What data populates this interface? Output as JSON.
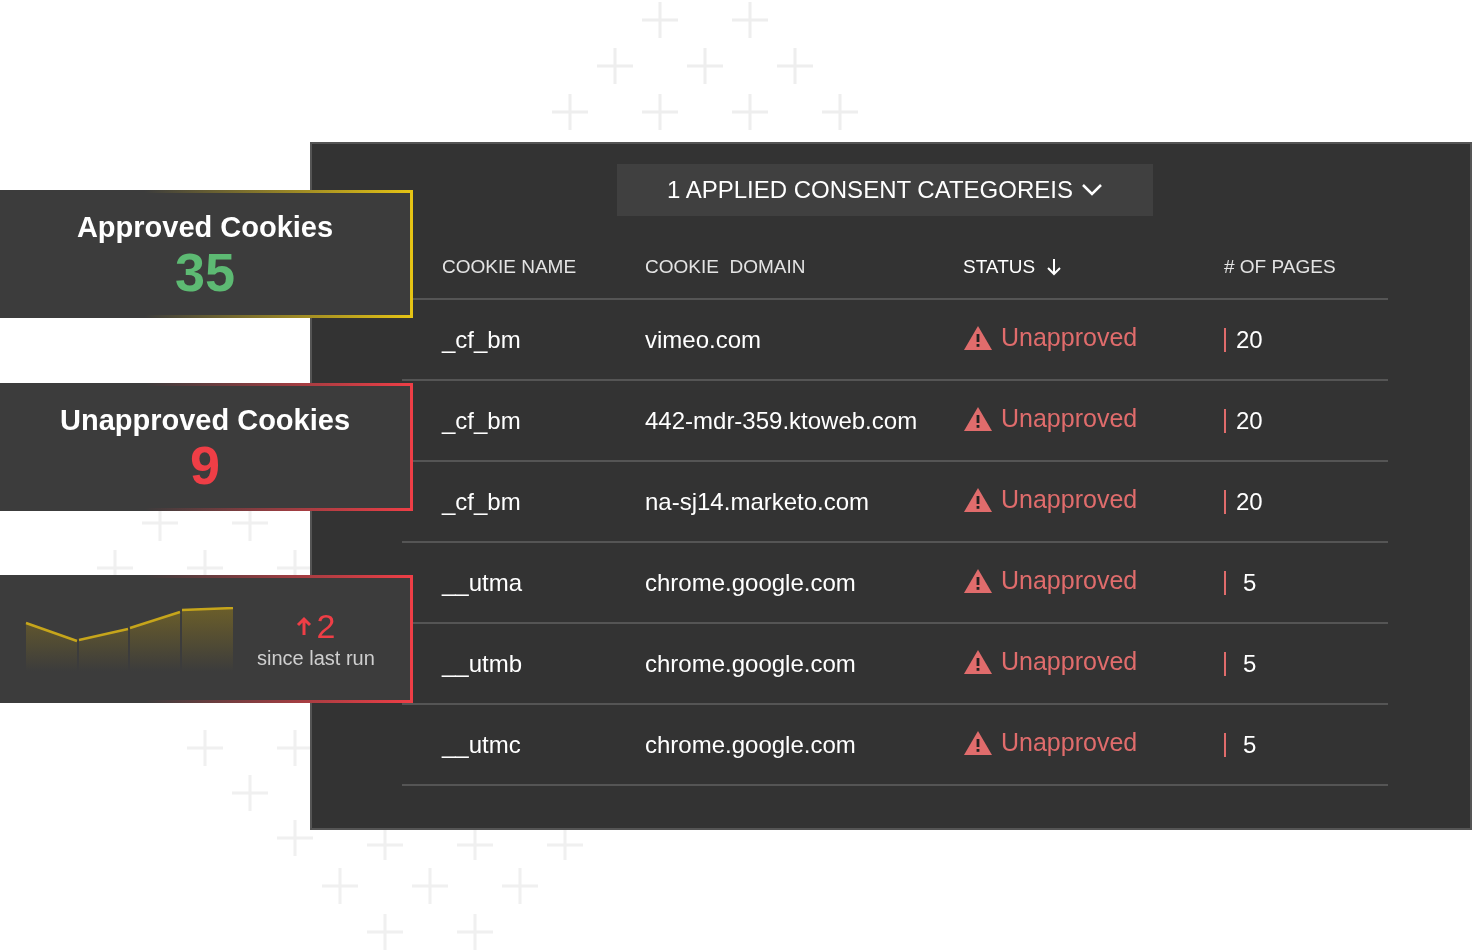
{
  "stat_cards": [
    {
      "kind": "approved",
      "title": "Approved Cookies",
      "value": "35"
    },
    {
      "kind": "unapproved",
      "title": "Unapproved Cookies",
      "value": "9"
    },
    {
      "kind": "trend",
      "change": "2",
      "caption": "since last run"
    }
  ],
  "panel": {
    "filter_button": "1 APPLIED CONSENT CATEGOREIS",
    "table": {
      "columns": [
        {
          "label": "COOKIE NAME",
          "sorted": false
        },
        {
          "label": "COOKIE  DOMAIN",
          "sorted": false
        },
        {
          "label": "STATUS",
          "sorted": true
        },
        {
          "label": "# OF PAGES",
          "sorted": false
        }
      ],
      "rows": [
        {
          "kind": "warning",
          "name": "_cf_bm",
          "domain": "vimeo.com",
          "status": "Unapproved",
          "pages": "20"
        },
        {
          "kind": "warning",
          "name": "_cf_bm",
          "domain": "442-mdr-359.ktoweb.com",
          "status": "Unapproved",
          "pages": "20"
        },
        {
          "kind": "warning",
          "name": "_cf_bm",
          "domain": "na-sj14.marketo.com",
          "status": "Unapproved",
          "pages": "20"
        },
        {
          "kind": "warning",
          "name": "__utma",
          "domain": "chrome.google.com",
          "status": "Unapproved",
          "pages": "5"
        },
        {
          "kind": "warning",
          "name": "__utmb",
          "domain": "chrome.google.com",
          "status": "Unapproved",
          "pages": "5"
        },
        {
          "kind": "warning",
          "name": "__utmc",
          "domain": "chrome.google.com",
          "status": "Unapproved",
          "pages": "5"
        }
      ]
    }
  }
}
